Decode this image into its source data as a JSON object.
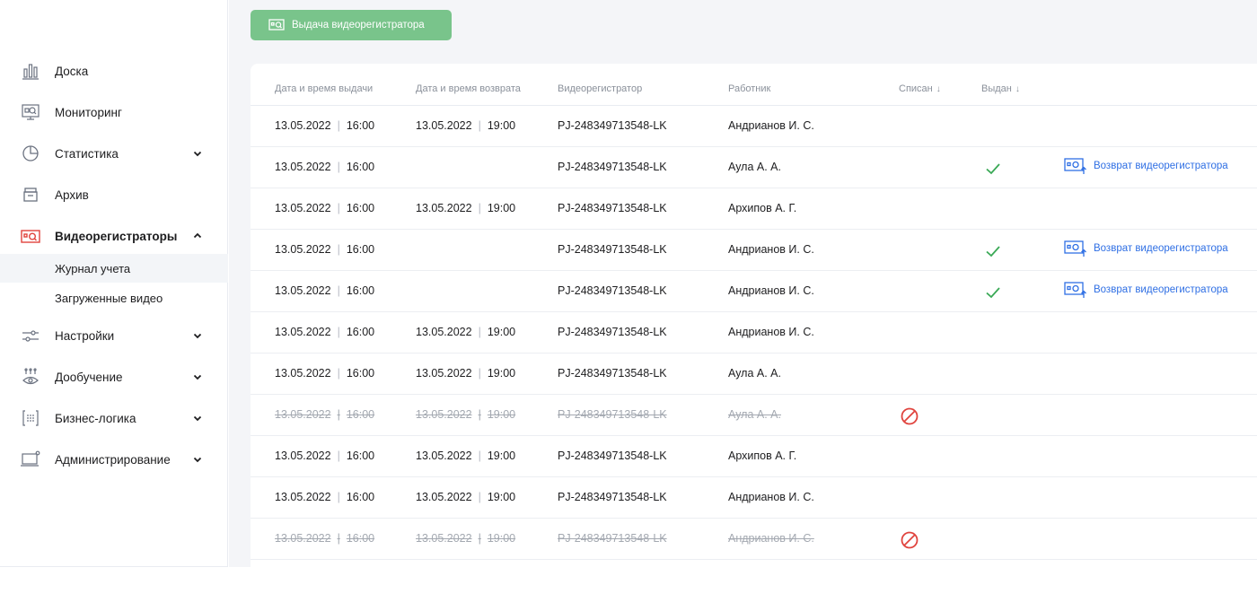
{
  "colors": {
    "accent_green": "#79c48b",
    "check_green": "#3aa956",
    "link_blue": "#2f6fe4",
    "cancel_red": "#e0433d",
    "active_icon_red": "#e0433d"
  },
  "sidebar": {
    "items": [
      {
        "label": "Доска",
        "icon": "dashboard-bars-icon",
        "expandable": false
      },
      {
        "label": "Мониторинг",
        "icon": "monitoring-screen-icon",
        "expandable": false
      },
      {
        "label": "Статистика",
        "icon": "pie-chart-icon",
        "expandable": true
      },
      {
        "label": "Архив",
        "icon": "archive-box-icon",
        "expandable": false
      },
      {
        "label": "Видеорегистраторы",
        "icon": "video-recorder-icon",
        "expandable": true,
        "expanded": true,
        "active": true
      },
      {
        "label": "Настройки",
        "icon": "sliders-icon",
        "expandable": true
      },
      {
        "label": "Дообучение",
        "icon": "neural-eye-icon",
        "expandable": true
      },
      {
        "label": "Бизнес-логика",
        "icon": "logic-grid-icon",
        "expandable": true
      },
      {
        "label": "Администрирование",
        "icon": "admin-laptop-icon",
        "expandable": true
      }
    ],
    "subitems": [
      {
        "label": "Журнал учета",
        "selected": true
      },
      {
        "label": "Загруженные видео",
        "selected": false
      }
    ]
  },
  "toolbar": {
    "issue_label": "Выдача видеорегистратора"
  },
  "table": {
    "headers": {
      "issue_dt": "Дата и время выдачи",
      "return_dt": "Дата и время возврата",
      "recorder": "Видеорегистратор",
      "employee": "Работник",
      "written_off": "Списан",
      "issued": "Выдан"
    },
    "sort_arrow": "↓",
    "return_label": "Возврат видеорегистратора",
    "rows": [
      {
        "issue_date": "13.05.2022",
        "issue_time": "16:00",
        "return_date": "13.05.2022",
        "return_time": "19:00",
        "recorder": "PJ-248349713548-LK",
        "employee": "Андрианов И. С.",
        "written_off": false,
        "issued": false,
        "return_action": false
      },
      {
        "issue_date": "13.05.2022",
        "issue_time": "16:00",
        "return_date": "",
        "return_time": "",
        "recorder": "PJ-248349713548-LK",
        "employee": "Аула А. А.",
        "written_off": false,
        "issued": true,
        "return_action": true
      },
      {
        "issue_date": "13.05.2022",
        "issue_time": "16:00",
        "return_date": "13.05.2022",
        "return_time": "19:00",
        "recorder": "PJ-248349713548-LK",
        "employee": "Архипов А. Г.",
        "written_off": false,
        "issued": false,
        "return_action": false
      },
      {
        "issue_date": "13.05.2022",
        "issue_time": "16:00",
        "return_date": "",
        "return_time": "",
        "recorder": "PJ-248349713548-LK",
        "employee": "Андрианов И. С.",
        "written_off": false,
        "issued": true,
        "return_action": true
      },
      {
        "issue_date": "13.05.2022",
        "issue_time": "16:00",
        "return_date": "",
        "return_time": "",
        "recorder": "PJ-248349713548-LK",
        "employee": "Андрианов И. С.",
        "written_off": false,
        "issued": true,
        "return_action": true
      },
      {
        "issue_date": "13.05.2022",
        "issue_time": "16:00",
        "return_date": "13.05.2022",
        "return_time": "19:00",
        "recorder": "PJ-248349713548-LK",
        "employee": "Андрианов И. С.",
        "written_off": false,
        "issued": false,
        "return_action": false
      },
      {
        "issue_date": "13.05.2022",
        "issue_time": "16:00",
        "return_date": "13.05.2022",
        "return_time": "19:00",
        "recorder": "PJ-248349713548-LK",
        "employee": "Аула А. А.",
        "written_off": false,
        "issued": false,
        "return_action": false
      },
      {
        "issue_date": "13.05.2022",
        "issue_time": "16:00",
        "return_date": "13.05.2022",
        "return_time": "19:00",
        "recorder": "PJ-248349713548-LK",
        "employee": "Аула А. А.",
        "written_off": true,
        "issued": false,
        "return_action": false
      },
      {
        "issue_date": "13.05.2022",
        "issue_time": "16:00",
        "return_date": "13.05.2022",
        "return_time": "19:00",
        "recorder": "PJ-248349713548-LK",
        "employee": "Архипов А. Г.",
        "written_off": false,
        "issued": false,
        "return_action": false
      },
      {
        "issue_date": "13.05.2022",
        "issue_time": "16:00",
        "return_date": "13.05.2022",
        "return_time": "19:00",
        "recorder": "PJ-248349713548-LK",
        "employee": "Андрианов И. С.",
        "written_off": false,
        "issued": false,
        "return_action": false
      },
      {
        "issue_date": "13.05.2022",
        "issue_time": "16:00",
        "return_date": "13.05.2022",
        "return_time": "19:00",
        "recorder": "PJ-248349713548-LK",
        "employee": "Андрианов И. С.",
        "written_off": true,
        "issued": false,
        "return_action": false
      }
    ]
  }
}
